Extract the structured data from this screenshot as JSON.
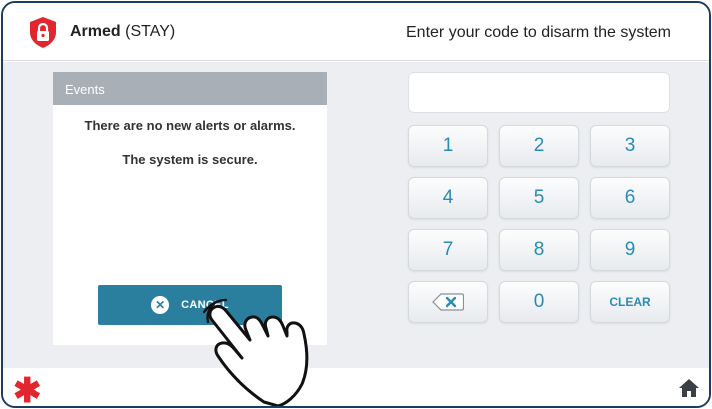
{
  "header": {
    "status_bold": "Armed",
    "status_mode": " (STAY)",
    "prompt": "Enter your code to disarm the system"
  },
  "events": {
    "title": "Events",
    "line1": "There are no new alerts or alarms.",
    "line2": "The system is secure.",
    "cancel_label": "CANCEL"
  },
  "code_input": {
    "value": ""
  },
  "keypad": {
    "k1": "1",
    "k2": "2",
    "k3": "3",
    "k4": "4",
    "k5": "5",
    "k6": "6",
    "k7": "7",
    "k8": "8",
    "k9": "9",
    "k0": "0",
    "clear": "CLEAR",
    "backspace_icon": "backspace-icon"
  },
  "footer": {
    "left_icon": "asterisk-icon",
    "right_icon": "home-icon"
  },
  "colors": {
    "brand_red": "#e1262d",
    "accent_blue": "#2a7f9f",
    "key_text": "#2a8bb5",
    "frame": "#1d3d5c"
  }
}
